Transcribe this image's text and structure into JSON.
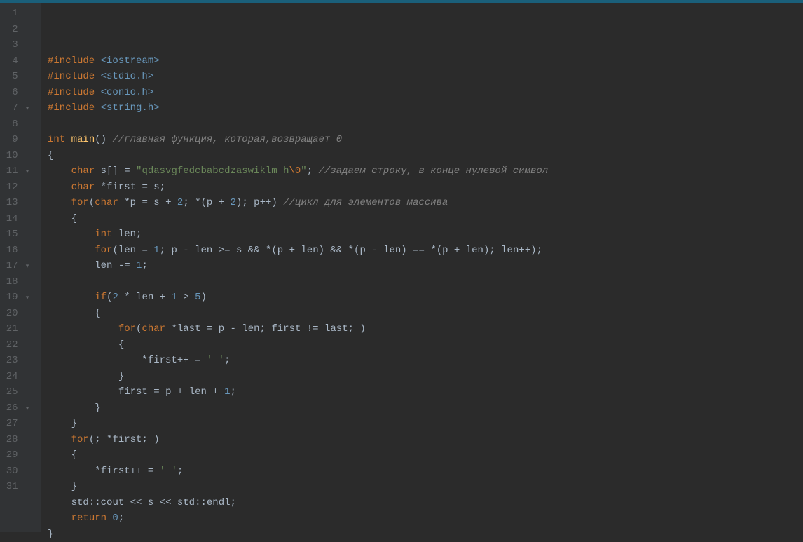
{
  "line_count": 31,
  "collapsible_lines": [
    7,
    11,
    17,
    19,
    26
  ],
  "code_lines": [
    {
      "segments": [
        {
          "t": "#include ",
          "c": "pp"
        },
        {
          "t": "<iostream>",
          "c": "ang"
        }
      ]
    },
    {
      "segments": [
        {
          "t": "#include ",
          "c": "pp"
        },
        {
          "t": "<stdio.h>",
          "c": "ang"
        }
      ]
    },
    {
      "segments": [
        {
          "t": "#include ",
          "c": "pp"
        },
        {
          "t": "<conio.h>",
          "c": "ang"
        }
      ]
    },
    {
      "segments": [
        {
          "t": "#include ",
          "c": "pp"
        },
        {
          "t": "<string.h>",
          "c": "ang"
        }
      ]
    },
    {
      "segments": []
    },
    {
      "segments": [
        {
          "t": "int ",
          "c": "kw"
        },
        {
          "t": "main",
          "c": "fn"
        },
        {
          "t": "() ",
          "c": "punct"
        },
        {
          "t": "//главная функция, которая,возвращает 0",
          "c": "cmt"
        }
      ]
    },
    {
      "segments": [
        {
          "t": "{",
          "c": "punct"
        }
      ]
    },
    {
      "segments": [
        {
          "t": "    ",
          "c": "id"
        },
        {
          "t": "char ",
          "c": "kw"
        },
        {
          "t": "s",
          "c": "id"
        },
        {
          "t": "[] = ",
          "c": "op"
        },
        {
          "t": "\"qdasvgfedcbabcdzaswiklm h",
          "c": "str"
        },
        {
          "t": "\\0",
          "c": "esc"
        },
        {
          "t": "\"",
          "c": "str"
        },
        {
          "t": "; ",
          "c": "punct"
        },
        {
          "t": "//задаем строку, в конце нулевой символ",
          "c": "cmt"
        }
      ]
    },
    {
      "segments": [
        {
          "t": "    ",
          "c": "id"
        },
        {
          "t": "char ",
          "c": "kw"
        },
        {
          "t": "*",
          "c": "op"
        },
        {
          "t": "first",
          "c": "id"
        },
        {
          "t": " = ",
          "c": "op"
        },
        {
          "t": "s",
          "c": "id"
        },
        {
          "t": ";",
          "c": "punct"
        }
      ]
    },
    {
      "segments": [
        {
          "t": "    ",
          "c": "id"
        },
        {
          "t": "for",
          "c": "kw"
        },
        {
          "t": "(",
          "c": "punct"
        },
        {
          "t": "char ",
          "c": "kw"
        },
        {
          "t": "*",
          "c": "op"
        },
        {
          "t": "p",
          "c": "id"
        },
        {
          "t": " = ",
          "c": "op"
        },
        {
          "t": "s",
          "c": "id"
        },
        {
          "t": " + ",
          "c": "op"
        },
        {
          "t": "2",
          "c": "num"
        },
        {
          "t": "; *(",
          "c": "punct"
        },
        {
          "t": "p",
          "c": "id"
        },
        {
          "t": " + ",
          "c": "op"
        },
        {
          "t": "2",
          "c": "num"
        },
        {
          "t": "); ",
          "c": "punct"
        },
        {
          "t": "p",
          "c": "id"
        },
        {
          "t": "++) ",
          "c": "punct"
        },
        {
          "t": "//цикл для элементов массива",
          "c": "cmt"
        }
      ]
    },
    {
      "segments": [
        {
          "t": "    {",
          "c": "punct"
        }
      ]
    },
    {
      "segments": [
        {
          "t": "        ",
          "c": "id"
        },
        {
          "t": "int ",
          "c": "kw"
        },
        {
          "t": "len",
          "c": "id"
        },
        {
          "t": ";",
          "c": "punct"
        }
      ]
    },
    {
      "segments": [
        {
          "t": "        ",
          "c": "id"
        },
        {
          "t": "for",
          "c": "kw"
        },
        {
          "t": "(",
          "c": "punct"
        },
        {
          "t": "len",
          "c": "id"
        },
        {
          "t": " = ",
          "c": "op"
        },
        {
          "t": "1",
          "c": "num"
        },
        {
          "t": "; ",
          "c": "punct"
        },
        {
          "t": "p",
          "c": "id"
        },
        {
          "t": " - ",
          "c": "op"
        },
        {
          "t": "len",
          "c": "id"
        },
        {
          "t": " >= ",
          "c": "op"
        },
        {
          "t": "s",
          "c": "id"
        },
        {
          "t": " && *(",
          "c": "op"
        },
        {
          "t": "p",
          "c": "id"
        },
        {
          "t": " + ",
          "c": "op"
        },
        {
          "t": "len",
          "c": "id"
        },
        {
          "t": ") && *(",
          "c": "op"
        },
        {
          "t": "p",
          "c": "id"
        },
        {
          "t": " - ",
          "c": "op"
        },
        {
          "t": "len",
          "c": "id"
        },
        {
          "t": ") == *(",
          "c": "op"
        },
        {
          "t": "p",
          "c": "id"
        },
        {
          "t": " + ",
          "c": "op"
        },
        {
          "t": "len",
          "c": "id"
        },
        {
          "t": "); ",
          "c": "punct"
        },
        {
          "t": "len",
          "c": "id"
        },
        {
          "t": "++);",
          "c": "punct"
        }
      ]
    },
    {
      "segments": [
        {
          "t": "        ",
          "c": "id"
        },
        {
          "t": "len",
          "c": "id"
        },
        {
          "t": " -= ",
          "c": "op"
        },
        {
          "t": "1",
          "c": "num"
        },
        {
          "t": ";",
          "c": "punct"
        }
      ]
    },
    {
      "segments": []
    },
    {
      "segments": [
        {
          "t": "        ",
          "c": "id"
        },
        {
          "t": "if",
          "c": "kw"
        },
        {
          "t": "(",
          "c": "punct"
        },
        {
          "t": "2",
          "c": "num"
        },
        {
          "t": " * ",
          "c": "op"
        },
        {
          "t": "len",
          "c": "id"
        },
        {
          "t": " + ",
          "c": "op"
        },
        {
          "t": "1",
          "c": "num"
        },
        {
          "t": " > ",
          "c": "op"
        },
        {
          "t": "5",
          "c": "num"
        },
        {
          "t": ")",
          "c": "punct"
        }
      ]
    },
    {
      "segments": [
        {
          "t": "        {",
          "c": "punct"
        }
      ]
    },
    {
      "segments": [
        {
          "t": "            ",
          "c": "id"
        },
        {
          "t": "for",
          "c": "kw"
        },
        {
          "t": "(",
          "c": "punct"
        },
        {
          "t": "char ",
          "c": "kw"
        },
        {
          "t": "*",
          "c": "op"
        },
        {
          "t": "last",
          "c": "id"
        },
        {
          "t": " = ",
          "c": "op"
        },
        {
          "t": "p",
          "c": "id"
        },
        {
          "t": " - ",
          "c": "op"
        },
        {
          "t": "len",
          "c": "id"
        },
        {
          "t": "; ",
          "c": "punct"
        },
        {
          "t": "first",
          "c": "id"
        },
        {
          "t": " != ",
          "c": "op"
        },
        {
          "t": "last",
          "c": "id"
        },
        {
          "t": "; )",
          "c": "punct"
        }
      ]
    },
    {
      "segments": [
        {
          "t": "            {",
          "c": "punct"
        }
      ]
    },
    {
      "segments": [
        {
          "t": "                *",
          "c": "op"
        },
        {
          "t": "first",
          "c": "id"
        },
        {
          "t": "++ = ",
          "c": "op"
        },
        {
          "t": "' '",
          "c": "str"
        },
        {
          "t": ";",
          "c": "punct"
        }
      ]
    },
    {
      "segments": [
        {
          "t": "            }",
          "c": "punct"
        }
      ]
    },
    {
      "segments": [
        {
          "t": "            ",
          "c": "id"
        },
        {
          "t": "first",
          "c": "id"
        },
        {
          "t": " = ",
          "c": "op"
        },
        {
          "t": "p",
          "c": "id"
        },
        {
          "t": " + ",
          "c": "op"
        },
        {
          "t": "len",
          "c": "id"
        },
        {
          "t": " + ",
          "c": "op"
        },
        {
          "t": "1",
          "c": "num"
        },
        {
          "t": ";",
          "c": "punct"
        }
      ]
    },
    {
      "segments": [
        {
          "t": "        }",
          "c": "punct"
        }
      ]
    },
    {
      "segments": [
        {
          "t": "    }",
          "c": "punct"
        }
      ]
    },
    {
      "segments": [
        {
          "t": "    ",
          "c": "id"
        },
        {
          "t": "for",
          "c": "kw"
        },
        {
          "t": "(; *",
          "c": "punct"
        },
        {
          "t": "first",
          "c": "id"
        },
        {
          "t": "; )",
          "c": "punct"
        }
      ]
    },
    {
      "segments": [
        {
          "t": "    {",
          "c": "punct"
        }
      ]
    },
    {
      "segments": [
        {
          "t": "        *",
          "c": "op"
        },
        {
          "t": "first",
          "c": "id"
        },
        {
          "t": "++ = ",
          "c": "op"
        },
        {
          "t": "' '",
          "c": "str"
        },
        {
          "t": ";",
          "c": "punct"
        }
      ]
    },
    {
      "segments": [
        {
          "t": "    }",
          "c": "punct"
        }
      ]
    },
    {
      "segments": [
        {
          "t": "    ",
          "c": "id"
        },
        {
          "t": "std",
          "c": "id"
        },
        {
          "t": "::",
          "c": "op"
        },
        {
          "t": "cout",
          "c": "id"
        },
        {
          "t": " << ",
          "c": "op"
        },
        {
          "t": "s",
          "c": "id"
        },
        {
          "t": " << ",
          "c": "op"
        },
        {
          "t": "std",
          "c": "id"
        },
        {
          "t": "::",
          "c": "op"
        },
        {
          "t": "endl",
          "c": "id"
        },
        {
          "t": ";",
          "c": "punct"
        }
      ]
    },
    {
      "segments": [
        {
          "t": "    ",
          "c": "id"
        },
        {
          "t": "return ",
          "c": "kw"
        },
        {
          "t": "0",
          "c": "num"
        },
        {
          "t": ";",
          "c": "punct"
        }
      ]
    },
    {
      "segments": [
        {
          "t": "}",
          "c": "punct"
        }
      ]
    }
  ]
}
